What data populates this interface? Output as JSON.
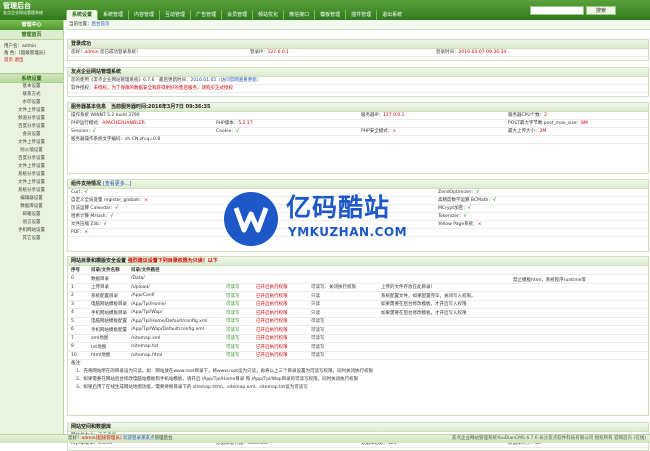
{
  "app": {
    "title": "管理后台",
    "subtitle": "友点企业网站管理系统"
  },
  "nav": {
    "tabs": [
      "系统设置",
      "系统管理",
      "内容管理",
      "互动管理",
      "广告管理",
      "会员管理",
      "频站优化",
      "微信接口",
      "模板管理",
      "插件管理",
      "退出系统"
    ],
    "active": 0
  },
  "search": {
    "placeholder": "",
    "go": "搜索"
  },
  "sidebar": {
    "header": "管理中心",
    "header2": "管理首页",
    "user_label": "用户名：",
    "user": "admin",
    "role_label": "角 色：",
    "role": "[超级管理员]",
    "links": [
      "首页",
      "退出"
    ],
    "section": "系统设置",
    "items": [
      "基本设置",
      "联系方式",
      "水印设置",
      "文件上传设置",
      "频道分享设置",
      "百度分享设置",
      "会员设置",
      "文件上传设置",
      "防火墙设置",
      "百度分享设置",
      "文件上传设置",
      "系统分享设置",
      "文件上传设置",
      "系统分享设置",
      "编辑器设置",
      "数据库设置",
      "邮箱设置",
      "语言设置",
      "手机网站设置",
      "其它设置"
    ]
  },
  "breadcrumb": {
    "label": "当前位置：",
    "path": "后台首页"
  },
  "login": {
    "title": "登录成功",
    "greeting_pre": "您好！",
    "user": "admin",
    "greeting_post": " 您已成功登录系统！",
    "ip_label": "登录IP：",
    "ip": "127.0.0.1",
    "time_label": "登录时间：",
    "time": "2016-03-07 09:36:34"
  },
  "sysinfo": {
    "title": "友点企业网站管理系统",
    "line1_pre": "您的使用《友点企业网站管理系统》6.7.6　最后更新时间：",
    "date": "2016.01.05",
    "line1_link": "（访问官网查看更新）",
    "line2_label": "软件授权：",
    "line2": "未授权，为了保障的数据安全和获得更好的售后服务，请购买正式授权"
  },
  "server": {
    "title": "服务器基本信息　当前服务器时间:2016年3月7日 09:36:35",
    "rows": [
      [
        "操作系统",
        "WINNT  5.2 build 3790",
        "服务器IP：",
        "127.0.0.1",
        "服务器CPU个数：",
        "2"
      ],
      [
        "PHP运行模式：",
        "APACHE2HANDLER",
        "PHP版本：",
        "5.2.17",
        "POST最大字节数 post_max_size：",
        "8M"
      ],
      [
        "Session：",
        "√",
        "Cookie：",
        "√",
        "PHP安全模式：",
        "×",
        "最大上传大小：",
        "2M"
      ],
      [
        "服务器操作系统文字编码：",
        "zh-CN,zh;q=0.8",
        "",
        "",
        ""
      ]
    ]
  },
  "ext": {
    "title": "组件支持情况",
    "link": "[查看更多...]",
    "rows": [
      [
        "Curl：",
        "√",
        "ZendOptimizer：",
        "√"
      ],
      [
        "自定义全局变量 register_globals：",
        "×",
        "高精度数学运算 BCMath：",
        "√"
      ],
      [
        "历法运算 Calendar：",
        "√",
        "MCrypt加密：",
        "√"
      ],
      [
        "哈希计算 MHash：",
        "√",
        "Tokenizer：",
        "√"
      ],
      [
        "文件压缩 Zlib：",
        "√",
        "Yellow Page系统：",
        "×"
      ],
      [
        "PDF：",
        "×",
        "",
        ""
      ]
    ]
  },
  "perm": {
    "title": "网站目录和模版安全设置",
    "title_note": "强烈建议设置下列目录权限为只读！以下",
    "headers": [
      "序号",
      "目录/文件名称",
      "目录/文件路径",
      "",
      "",
      "",
      ""
    ],
    "rows": [
      [
        "0",
        "数据目录",
        "/Data/",
        "",
        "",
        "",
        ""
      ],
      [
        "1",
        "上传目录",
        "/Upload/",
        "可读写",
        "已开启执行权限",
        "可读写、关闭执行权限",
        "上传的文件存放在此目录！"
      ],
      [
        "2",
        "系统配置目录",
        "/App/Conf/",
        "可读写",
        "已开启执行权限",
        "只读",
        "系统配置文件，如果配置完毕，关闭写入权限。"
      ],
      [
        "3",
        "电脑网站模板目录",
        "/App/Tpl/Home/",
        "可读写",
        "已开启执行权限",
        "只读",
        "如果需要在后台修改模板，才开启写入权限"
      ],
      [
        "4",
        "手机网站模板目录",
        "/App/Tpl/Wap/",
        "可读写",
        "已开启执行权限",
        "只读",
        "如果需要在后台修改模板，才开启写入权限"
      ],
      [
        "5",
        "电脑网站模板配置",
        "/App/Tpl/Home/Default/config.xml",
        "可读写",
        "已开启执行权限",
        "可读写",
        ""
      ],
      [
        "6",
        "手机网站模板配置",
        "/App/Tpl/Wap/Default/config.xml",
        "可读写",
        "已开启执行权限",
        "可读写",
        ""
      ],
      [
        "7",
        "xml地图",
        "/sitemap.xml",
        "可读写",
        "已开启执行权限",
        "可读写",
        ""
      ],
      [
        "8",
        "txt地图",
        "/sitemap.txt",
        "可读写",
        "已开启执行权限",
        "可读写",
        ""
      ],
      [
        "10",
        "html地图",
        "/sitemap.html",
        "可读写",
        "已开启执行权限",
        "可读写",
        ""
      ]
    ],
    "notes_title": "备注：",
    "notes": [
      "1、先将网站所在的目录设为只读，如：网站放在www.root目录下，将www.root设为只读，再将以上三个目录设置为可读写权限，同时关闭执行权限",
      "2、如果需要在网站后台修改电脑站模板和手机站模板，请开启 /App/Tpl/Home目录 和 /App/Tpl/Wap目录的可读写权限，同时关闭执行权限",
      "3、如果启用了在线生成网站地图功能，需要将根目录下的 sitemap.html、sitemap.xml、sitemap.txt设为可读写"
    ],
    "right_note": "禁止模板html，系统程序runtime等"
  },
  "db": {
    "title": "网站空间和数据库",
    "space_label": "网站总大小：",
    "space": "未去查询",
    "rows": [
      [
        "mysql版本：",
        "5.5.40"
      ],
      [
        "数据库服务器：",
        "localhost"
      ],
      [
        "数据库总数：",
        "123"
      ],
      [
        "数据库大小：",
        "0B"
      ]
    ]
  },
  "footer": {
    "left_pre": "您好！",
    "user": "admin",
    "left_role": "[超级管理员]",
    "left_link": "欢迎登录莱友点",
    "left_post": "管理后台",
    "right": "友点企业网站管理系统YouDianCMS 6.7.6 长沙友点软件科技有限公司 授权所有 官网首页 (在线)"
  },
  "watermark": {
    "brand": "亿码酷站",
    "url": "YMKUZHAN.COM"
  },
  "colors": {
    "nav": "#3f8a26",
    "accent_red": "#d10000",
    "accent_blue": "#1e58c8",
    "ok_green": "#2a8a17"
  }
}
